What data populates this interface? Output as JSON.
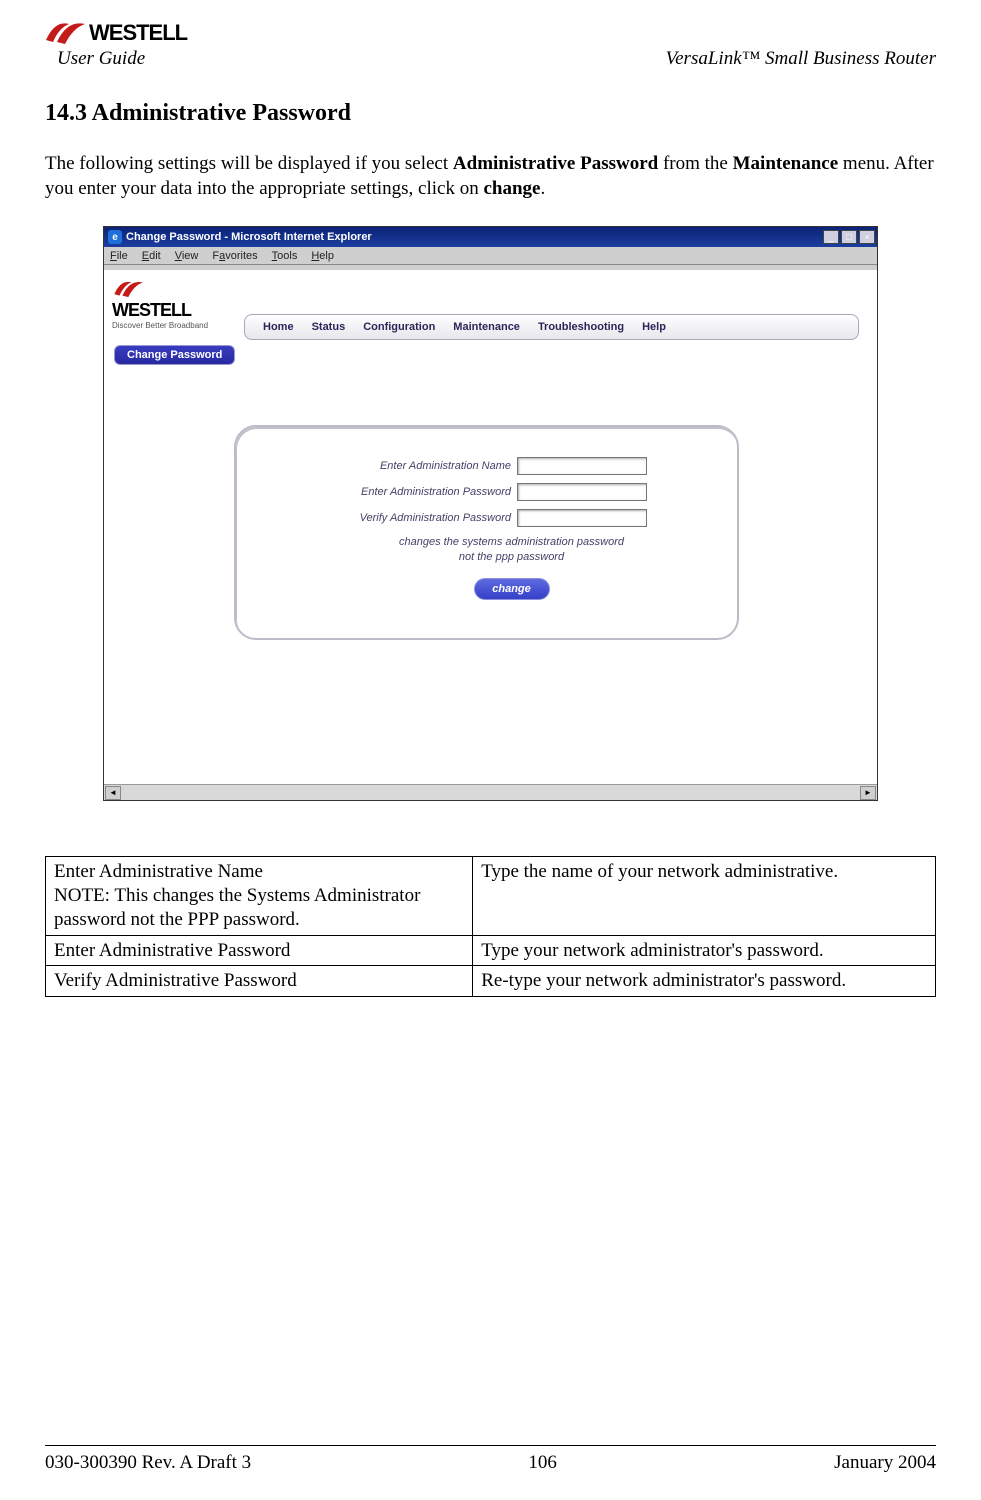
{
  "doc": {
    "brand": "WESTELL",
    "user_guide": "User Guide",
    "product": "VersaLink™  Small Business Router",
    "section_heading": "14.3 Administrative Password",
    "intro_pre": "The following settings will be displayed if you select ",
    "intro_b1": "Administrative Password",
    "intro_mid": " from the ",
    "intro_b2": "Maintenance",
    "intro_post1": " menu. After you enter your data into the appropriate settings, click on ",
    "intro_b3": "change",
    "intro_end": "."
  },
  "browser": {
    "title": "Change Password - Microsoft Internet Explorer",
    "menus": {
      "file": "File",
      "edit": "Edit",
      "view": "View",
      "favorites": "Favorites",
      "tools": "Tools",
      "help": "Help"
    },
    "logo_big": "WESTELL",
    "logo_tag": "Discover  Better  Broadband",
    "nav": {
      "home": "Home",
      "status": "Status",
      "config": "Configuration",
      "maint": "Maintenance",
      "trouble": "Troubleshooting",
      "help": "Help"
    },
    "tab_change_pw": "Change Password",
    "form": {
      "name_label": "Enter Administration Name",
      "pw_label": "Enter Administration Password",
      "verify_label": "Verify Administration Password",
      "hint_l1": "changes the systems administration password",
      "hint_l2": "not the ppp password",
      "change_btn": "change"
    }
  },
  "table_rows": [
    {
      "left_l1": "Enter Administrative Name",
      "left_l2": "NOTE: This changes the Systems Administrator password not the PPP password.",
      "right": "Type the name of your network administrative."
    },
    {
      "left_l1": "Enter Administrative Password",
      "left_l2": "",
      "right": "Type your network administrator's password."
    },
    {
      "left_l1": "Verify Administrative Password",
      "left_l2": "",
      "right": "Re-type your network administrator's password."
    }
  ],
  "footer": {
    "rev": "030-300390 Rev. A Draft 3",
    "page": "106",
    "date": "January 2004"
  }
}
